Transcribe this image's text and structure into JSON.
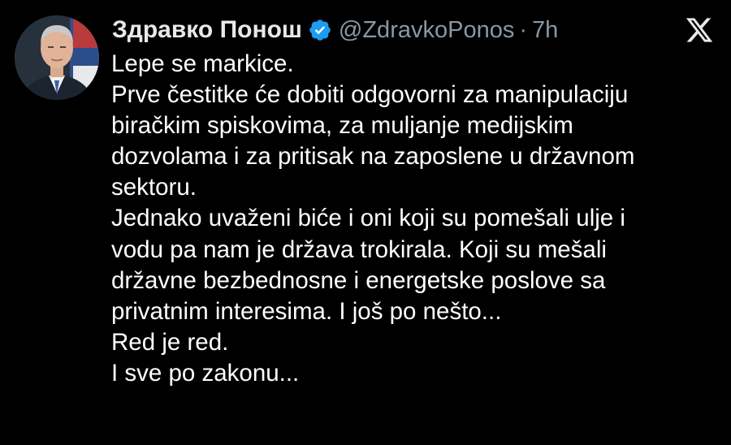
{
  "author": {
    "display_name": "Здравко Понош",
    "handle": "@ZdravkoPonos",
    "separator": "·",
    "time": "7h",
    "verified": true
  },
  "icons": {
    "verified": "verified-badge-icon",
    "platform": "x-logo-icon"
  },
  "colors": {
    "background": "#000000",
    "text": "#ffffff",
    "secondary_text": "#8b98a5",
    "verified_badge": "#1d9bf0"
  },
  "tweet": {
    "lines": [
      "Lepe se markice.",
      "Prve čestitke će dobiti odgovorni za manipulaciju",
      "biračkim spiskovima, za muljanje medijskim",
      "dozvolama i za pritisak na zaposlene u državnom",
      "sektoru.",
      "Jednako uvaženi biće i oni koji su pomešali ulje i",
      "vodu pa nam je država trokirala. Koji su mešali",
      "državne bezbednosne i energetske poslove sa",
      "privatnim interesima. I još po nešto...",
      "Red je red.",
      "I sve po zakonu..."
    ]
  }
}
